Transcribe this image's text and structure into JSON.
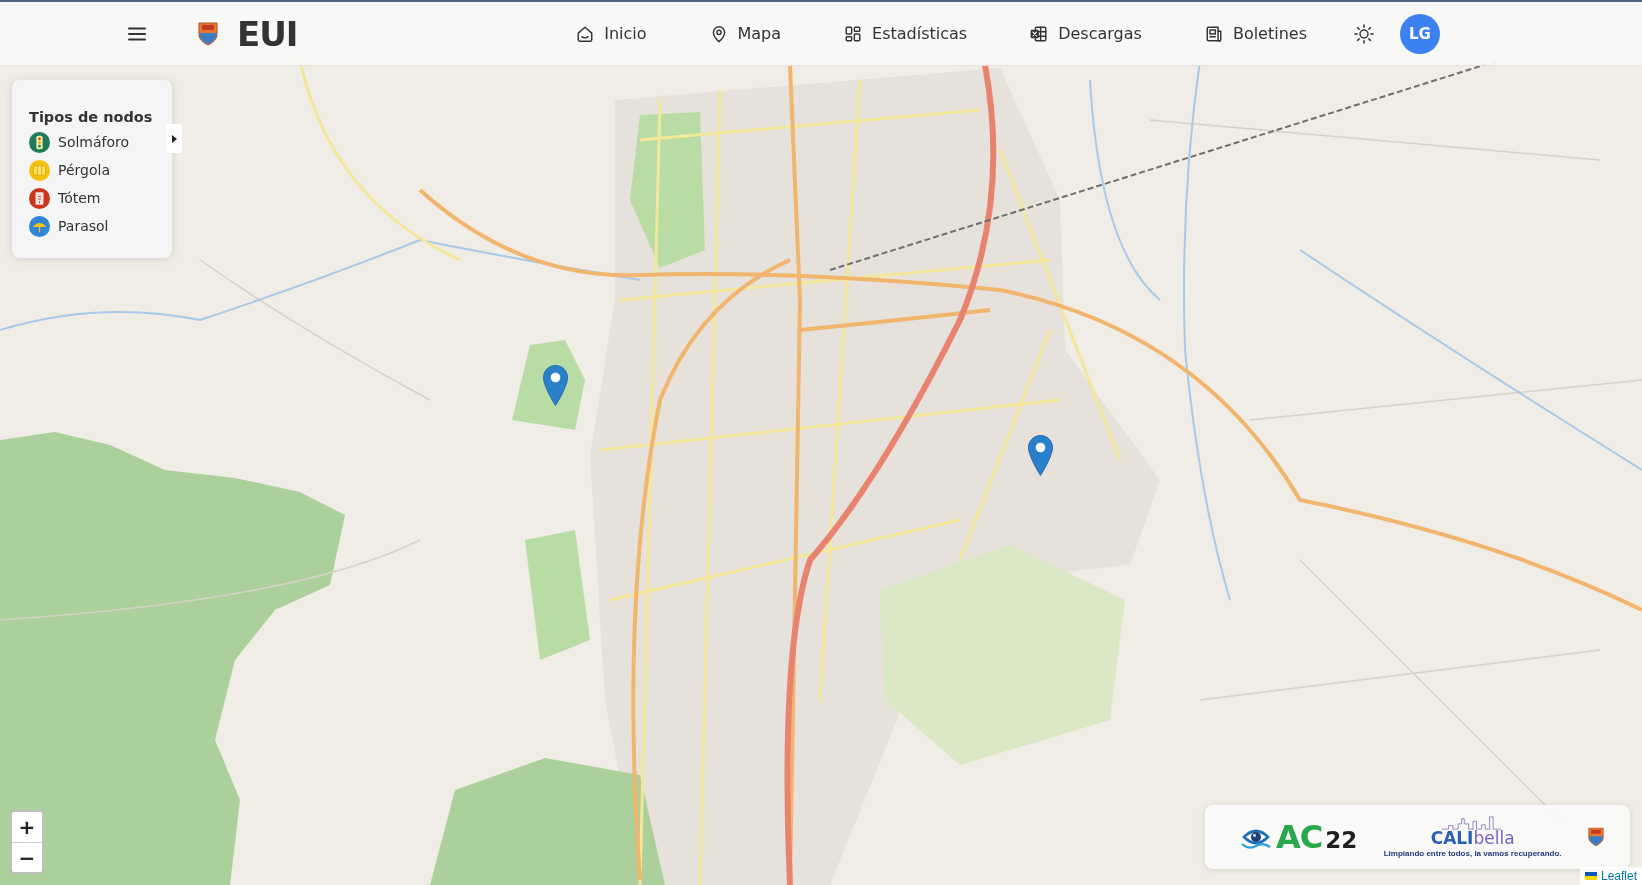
{
  "header": {
    "logo_text": "EUI",
    "nav": [
      {
        "kind": "home",
        "label": "Inicio"
      },
      {
        "kind": "pin",
        "label": "Mapa"
      },
      {
        "kind": "dashboard",
        "label": "Estadísticas"
      },
      {
        "kind": "spreadsheet",
        "label": "Descargas"
      },
      {
        "kind": "newspaper",
        "label": "Boletines"
      }
    ],
    "avatar": "LG"
  },
  "legend": {
    "title": "Tipos de nodos",
    "items": [
      {
        "kind": "traffic_light",
        "label": "Solmáforo",
        "color": "#1e7b5a"
      },
      {
        "kind": "pergola",
        "label": "Pérgola",
        "color": "#f4c20d"
      },
      {
        "kind": "totem",
        "label": "Tótem",
        "color": "#c9361c"
      },
      {
        "kind": "parasol",
        "label": "Parasol",
        "color": "#2f85d8"
      }
    ]
  },
  "zoom_control": {
    "zoom_in": "+",
    "zoom_out": "−"
  },
  "partner_logos": [
    {
      "kind": "ac22",
      "name": "AC",
      "number": "22"
    },
    {
      "kind": "calibella",
      "name": "CALI",
      "suffix": "bella",
      "tagline": "Limpiando entre todos, la vamos recuperando."
    },
    {
      "kind": "crest"
    }
  ],
  "attribution": "Leaflet"
}
